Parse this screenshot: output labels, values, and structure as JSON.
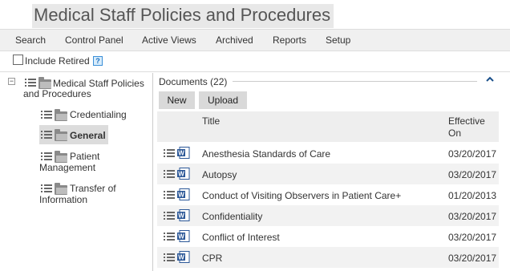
{
  "page": {
    "title": "Medical Staff Policies and Procedures"
  },
  "nav": {
    "items": [
      {
        "label": "Search"
      },
      {
        "label": "Control Panel"
      },
      {
        "label": "Active Views"
      },
      {
        "label": "Archived"
      },
      {
        "label": "Reports"
      },
      {
        "label": "Setup"
      }
    ]
  },
  "filter": {
    "include_retired_label": "Include Retired",
    "include_retired_checked": false,
    "help_glyph": "?"
  },
  "tree": {
    "collapse_glyph": "−",
    "root": {
      "line1": "Medical Staff Policies",
      "line2": "and Procedures"
    },
    "children": [
      {
        "line1": "Credentialing",
        "line2": "",
        "selected": false
      },
      {
        "line1": "General",
        "line2": "",
        "selected": true
      },
      {
        "line1": "Patient",
        "line2": "Management",
        "selected": false
      },
      {
        "line1": "Transfer of",
        "line2": "Information",
        "selected": false
      }
    ]
  },
  "documents": {
    "header": "Documents (22)",
    "new_label": "New",
    "upload_label": "Upload",
    "columns": {
      "title": "Title",
      "effective_line1": "Effective",
      "effective_line2": "On"
    },
    "rows": [
      {
        "title": "Anesthesia Standards of Care",
        "effective": "03/20/2017"
      },
      {
        "title": "Autopsy",
        "effective": "03/20/2017"
      },
      {
        "title": "Conduct of Visiting Observers in Patient Care+",
        "effective": "01/20/2013"
      },
      {
        "title": "Confidentiality",
        "effective": "03/20/2017"
      },
      {
        "title": "Conflict of Interest",
        "effective": "03/20/2017"
      },
      {
        "title": "CPR",
        "effective": "03/20/2017"
      }
    ]
  },
  "icons": {
    "list": "list-icon",
    "folder": "folder-icon",
    "word": "word-document-icon",
    "caret": "caret-up-icon",
    "help": "help-icon"
  },
  "colors": {
    "word_blue": "#2b5797",
    "help_blue": "#3a8fd8",
    "selected_bg": "#dcdcdc"
  }
}
